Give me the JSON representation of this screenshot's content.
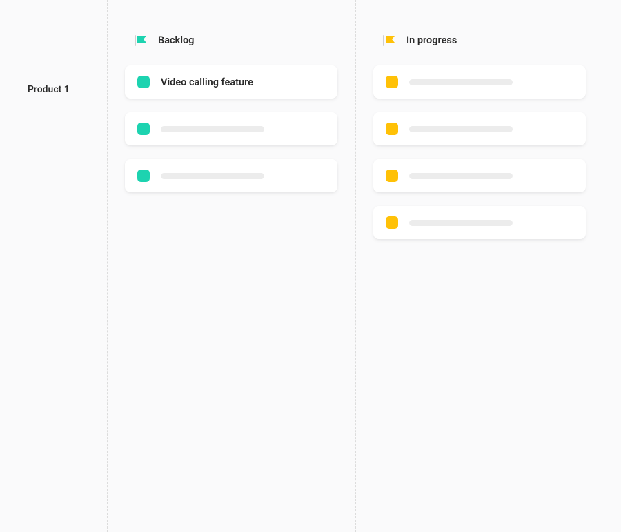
{
  "sidebar": {
    "product_label": "Product 1"
  },
  "columns": [
    {
      "id": "backlog",
      "title": "Backlog",
      "color": "#1dd3b0",
      "cards": [
        {
          "title": "Video calling feature",
          "placeholder": false
        },
        {
          "title": "",
          "placeholder": true
        },
        {
          "title": "",
          "placeholder": true
        }
      ]
    },
    {
      "id": "in-progress",
      "title": "In progress",
      "color": "#ffc107",
      "cards": [
        {
          "title": "",
          "placeholder": true
        },
        {
          "title": "",
          "placeholder": true
        },
        {
          "title": "",
          "placeholder": true
        },
        {
          "title": "",
          "placeholder": true
        }
      ]
    }
  ]
}
